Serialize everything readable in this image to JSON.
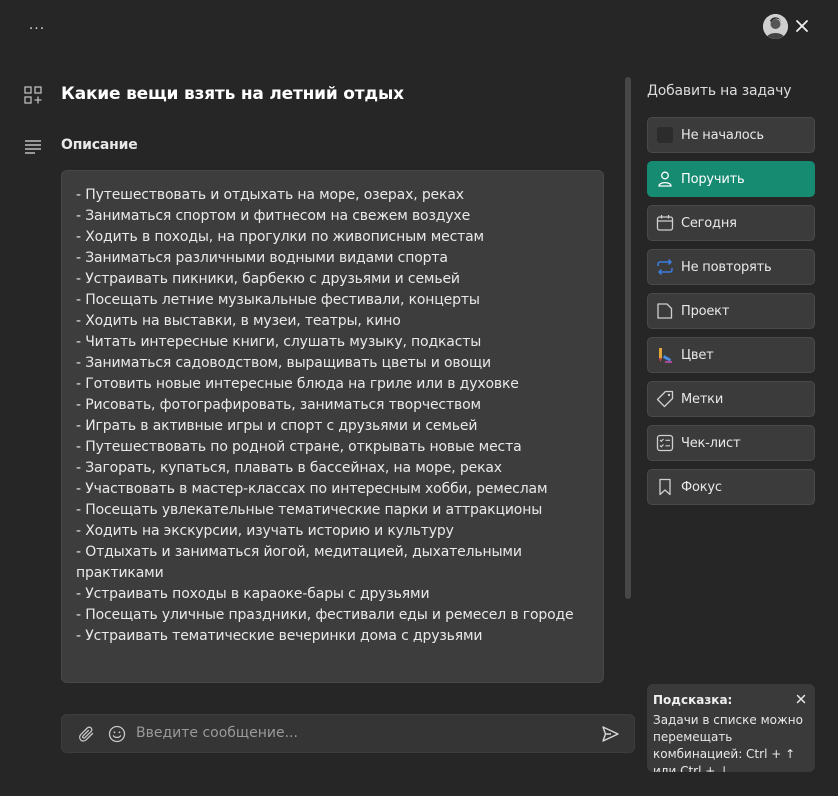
{
  "header": {
    "more_label": "...",
    "avatar_icon": "user-avatar",
    "close_icon": "close-icon"
  },
  "task": {
    "title": "Какие вещи взять на летний отдых",
    "description_label": "Описание",
    "description_lines": [
      "- Путешествовать и отдыхать на море, озерах, реках",
      "- Заниматься спортом и фитнесом на свежем воздухе",
      "- Ходить в походы, на прогулки по живописным местам",
      "- Заниматься различными водными видами спорта",
      "- Устраивать пикники, барбекю с друзьями и семьей",
      "- Посещать летние музыкальные фестивали, концерты",
      "- Ходить на выставки, в музеи, театры, кино",
      "- Читать интересные книги, слушать музыку, подкасты",
      "- Заниматься садоводством, выращивать цветы и овощи",
      "- Готовить новые интересные блюда на гриле или в духовке",
      "- Рисовать, фотографировать, заниматься творчеством",
      "- Играть в активные игры и спорт с друзьями и семьей",
      "- Путешествовать по родной стране, открывать новые места",
      "- Загорать, купаться, плавать в бассейнах, на море, реках",
      "- Участвовать в мастер-классах по интересным хобби, ремеслам",
      "- Посещать увлекательные тематические парки и аттракционы",
      "- Ходить на экскурсии, изучать историю и культуру",
      "- Отдыхать и заниматься йогой, медитацией, дыхательными",
      "практиками",
      "- Устраивать походы в караоке-бары с друзьями",
      "- Посещать уличные праздники, фестивали еды и ремесел в городе",
      "- Устраивать тематические вечеринки дома с друзьями"
    ]
  },
  "message": {
    "placeholder": "Введите сообщение..."
  },
  "panel": {
    "title": "Добавить на задачу",
    "buttons": [
      {
        "label": "Не началось",
        "icon": "status-square-icon"
      },
      {
        "label": "Поручить",
        "icon": "person-icon"
      },
      {
        "label": "Сегодня",
        "icon": "calendar-icon"
      },
      {
        "label": "Не повторять",
        "icon": "repeat-icon"
      },
      {
        "label": "Проект",
        "icon": "folder-icon"
      },
      {
        "label": "Цвет",
        "icon": "paint-icon"
      },
      {
        "label": "Метки",
        "icon": "tag-icon"
      },
      {
        "label": "Чек-лист",
        "icon": "checklist-icon"
      },
      {
        "label": "Фокус",
        "icon": "bookmark-icon"
      }
    ]
  },
  "hint": {
    "title": "Подсказка:",
    "text": "Задачи в списке можно перемещать комбинацией: Ctrl + ↑ или Ctrl + ↓"
  },
  "colors": {
    "accent": "#178a72",
    "background": "#262626"
  }
}
